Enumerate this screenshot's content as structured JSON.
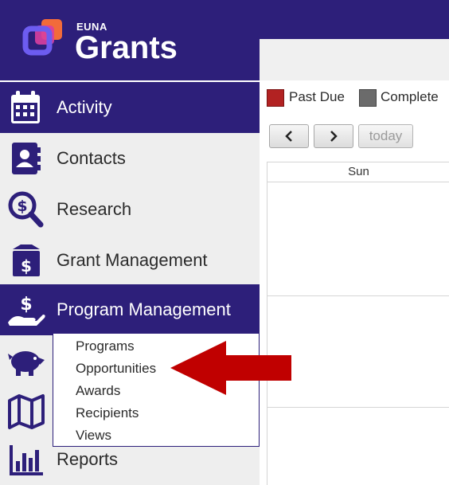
{
  "brand": {
    "small": "EUNA",
    "big": "Grants"
  },
  "sidebar": {
    "items": [
      {
        "label": "Activity",
        "icon": "calendar-icon",
        "active": true
      },
      {
        "label": "Contacts",
        "icon": "contact-book-icon",
        "active": false
      },
      {
        "label": "Research",
        "icon": "dollar-magnifier-icon",
        "active": false
      },
      {
        "label": "Grant Management",
        "icon": "box-dollar-icon",
        "active": false
      },
      {
        "label": "Program Management",
        "icon": "hand-dollar-icon",
        "active": true
      },
      {
        "label": "Reports",
        "icon": "bar-chart-icon",
        "active": false
      }
    ],
    "hidden_icons": [
      "piggy-bank-icon",
      "map-icon"
    ]
  },
  "submenu": {
    "items": [
      "Programs",
      "Opportunities",
      "Awards",
      "Recipients",
      "Views"
    ]
  },
  "legend": {
    "past_due": {
      "label": "Past Due",
      "color": "#b22222"
    },
    "complete": {
      "label": "Complete",
      "color": "#6b6b6b"
    }
  },
  "calendar": {
    "today_label": "today",
    "day_header": "Sun"
  },
  "colors": {
    "brand": "#2d1f7a",
    "arrow": "#c00000",
    "logo_orange": "#f26b3a",
    "logo_pink": "#d93fa0",
    "logo_violet": "#6d5cf0"
  }
}
